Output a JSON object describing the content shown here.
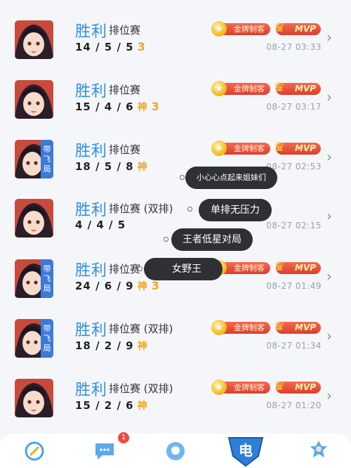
{
  "matches": [
    {
      "result": "胜利",
      "mode": "排位赛",
      "kda": "14 / 5 / 5",
      "god": "",
      "triple": "3",
      "ribbon": false,
      "badge_gold": "金牌制客",
      "badge_mvp": "MVP",
      "time": "08-27 03:33"
    },
    {
      "result": "胜利",
      "mode": "排位赛",
      "kda": "15 / 4 / 6",
      "god": "神",
      "triple": "3",
      "ribbon": false,
      "badge_gold": "金牌制客",
      "badge_mvp": "MVP",
      "time": "08-27 03:17"
    },
    {
      "result": "胜利",
      "mode": "排位赛",
      "kda": "18 / 5 / 8",
      "god": "神",
      "triple": "",
      "ribbon": true,
      "badge_gold": "金牌制客",
      "badge_mvp": "MVP",
      "time": "08-27 02:53"
    },
    {
      "result": "胜利",
      "mode": "排位赛 (双排)",
      "kda": "4 / 4 / 5",
      "god": "",
      "triple": "",
      "ribbon": false,
      "badge_gold": "",
      "badge_mvp": "",
      "time": "08-27 02:15"
    },
    {
      "result": "胜利",
      "mode": "排位赛 (双排)",
      "kda": "24 / 6 / 9",
      "god": "神",
      "triple": "3",
      "ribbon": true,
      "badge_gold": "金牌制客",
      "badge_mvp": "MVP",
      "time": "08-27 01:49"
    },
    {
      "result": "胜利",
      "mode": "排位赛 (双排)",
      "kda": "18 / 2 / 9",
      "god": "神",
      "triple": "",
      "ribbon": true,
      "badge_gold": "金牌制客",
      "badge_mvp": "MVP",
      "time": "08-27 01:34"
    },
    {
      "result": "胜利",
      "mode": "排位赛 (双排)",
      "kda": "15 / 2 / 6",
      "god": "神",
      "triple": "",
      "ribbon": false,
      "badge_gold": "金牌制客",
      "badge_mvp": "MVP",
      "time": "08-27 01:20"
    }
  ],
  "ribbon_text": [
    "带",
    "飞",
    "局"
  ],
  "bubbles": [
    "小心心点起来姐妹们",
    "单排无压力",
    "王者低星对局",
    "女野王"
  ],
  "tabbar": {
    "notification_count": "1",
    "icons": [
      "target-icon",
      "chat-icon",
      "search-icon",
      "esports-shield-icon",
      "character-icon"
    ]
  },
  "colors": {
    "victory": "#2f8fe3",
    "accent_gold": "#f0a722",
    "badge_red": "#dc3d2e"
  }
}
